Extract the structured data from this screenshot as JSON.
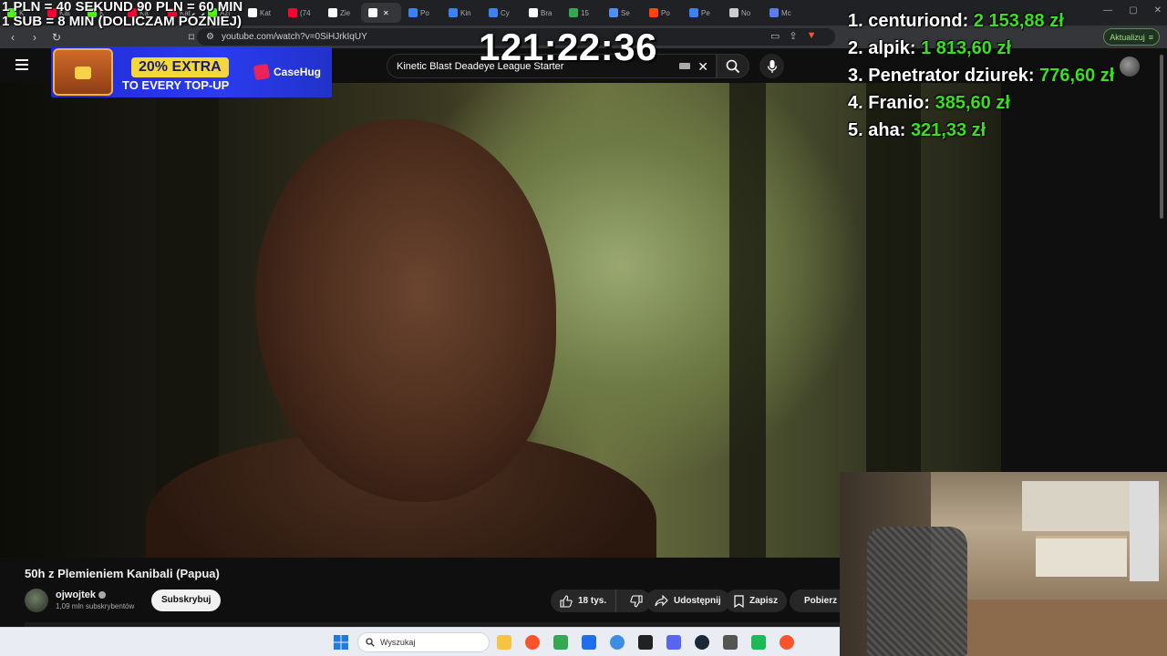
{
  "browser": {
    "tabs": [
      {
        "label": "K",
        "icon": "kick-icon",
        "color": "#53fc18"
      },
      {
        "label": "Kat",
        "icon": "youtube-icon",
        "color": "#ff0033"
      },
      {
        "label": "K",
        "icon": "kick-icon",
        "color": "#53fc18"
      },
      {
        "label": "Ka",
        "icon": "youtube-icon",
        "color": "#ff0033"
      },
      {
        "label": "Kat",
        "icon": "youtube-icon",
        "color": "#ff0033"
      },
      {
        "label": "Azi",
        "icon": "kick-icon",
        "color": "#53fc18"
      },
      {
        "label": "Kat",
        "icon": "b-icon",
        "color": "#ffffff"
      },
      {
        "label": "(74",
        "icon": "youtube-icon",
        "color": "#ff0033"
      },
      {
        "label": "Zie",
        "icon": "x-icon",
        "color": "#ffffff"
      },
      {
        "label": "",
        "icon": "speaker-icon",
        "color": "#ffffff",
        "active": true
      },
      {
        "label": "Po",
        "icon": "shield-icon",
        "color": "#3b82f6"
      },
      {
        "label": "Kin",
        "icon": "shield-icon",
        "color": "#3b82f6"
      },
      {
        "label": "Cy",
        "icon": "shield-icon",
        "color": "#3b82f6"
      },
      {
        "label": "Bra",
        "icon": "x-icon",
        "color": "#ffffff"
      },
      {
        "label": "15",
        "icon": "chrome-icon",
        "color": "#34a853"
      },
      {
        "label": "Se",
        "icon": "doc-icon",
        "color": "#4f8ef7"
      },
      {
        "label": "Po",
        "icon": "reddit-icon",
        "color": "#ff4500"
      },
      {
        "label": "Pe",
        "icon": "shield-icon",
        "color": "#3b82f6"
      },
      {
        "label": "No",
        "icon": "shield-icon",
        "color": "#cccccc"
      },
      {
        "label": "Mc",
        "icon": "gamepad-icon",
        "color": "#5b7bf0"
      }
    ],
    "url": "youtube.com/watch?v=0SiHJrkIqUY",
    "update_label": "Aktualizuj"
  },
  "overlays": {
    "donation_rule_line1": "1 PLN = 40 SEKUND 90 PLN = 60 MIN",
    "donation_rule_line2": "1 SUB = 8 MIN (DOLICZAM PÓŹNIEJ)",
    "timer": "121:22:36",
    "ad": {
      "headline": "20% EXTRA",
      "subline": "TO EVERY TOP-UP",
      "brand": "CaseHug"
    },
    "leaderboard": [
      {
        "rank": "1.",
        "name": "centuriond:",
        "amount": "2 153,88 zł"
      },
      {
        "rank": "2.",
        "name": "alpik:",
        "amount": "1 813,60 zł"
      },
      {
        "rank": "3.",
        "name": "Penetrator dziurek:",
        "amount": "776,60 zł"
      },
      {
        "rank": "4.",
        "name": "Franio:",
        "amount": "385,60 zł"
      },
      {
        "rank": "5.",
        "name": "aha:",
        "amount": "321,33 zł"
      }
    ]
  },
  "youtube": {
    "search_value": "Kinetic Blast Deadeye League Starter",
    "video_title": "50h z Plemieniem Kanibali (Papua)",
    "channel_name": "ojwojtek",
    "subscribers": "1,09 mln subskrybentów",
    "subscribe_label": "Subskrybuj",
    "likes": "18 tys.",
    "share_label": "Udostępnij",
    "save_label": "Zapisz",
    "download_label": "Pobierz"
  },
  "taskbar": {
    "search_placeholder": "Wyszukaj",
    "apps": [
      {
        "name": "file-explorer-icon",
        "color": "#f6c343"
      },
      {
        "name": "brave-icon",
        "color": "#fb542b"
      },
      {
        "name": "chrome-icon",
        "color": "#34a853"
      },
      {
        "name": "app-store-icon",
        "color": "#1f6feb"
      },
      {
        "name": "notepad-icon",
        "color": "#3a8ee6"
      },
      {
        "name": "obs-icon",
        "color": "#222222"
      },
      {
        "name": "discord-icon",
        "color": "#5865f2"
      },
      {
        "name": "steam-icon",
        "color": "#1b2838"
      },
      {
        "name": "calculator-icon",
        "color": "#555555"
      },
      {
        "name": "spotify-icon",
        "color": "#1db954"
      },
      {
        "name": "brave-icon",
        "color": "#fb542b"
      }
    ]
  }
}
